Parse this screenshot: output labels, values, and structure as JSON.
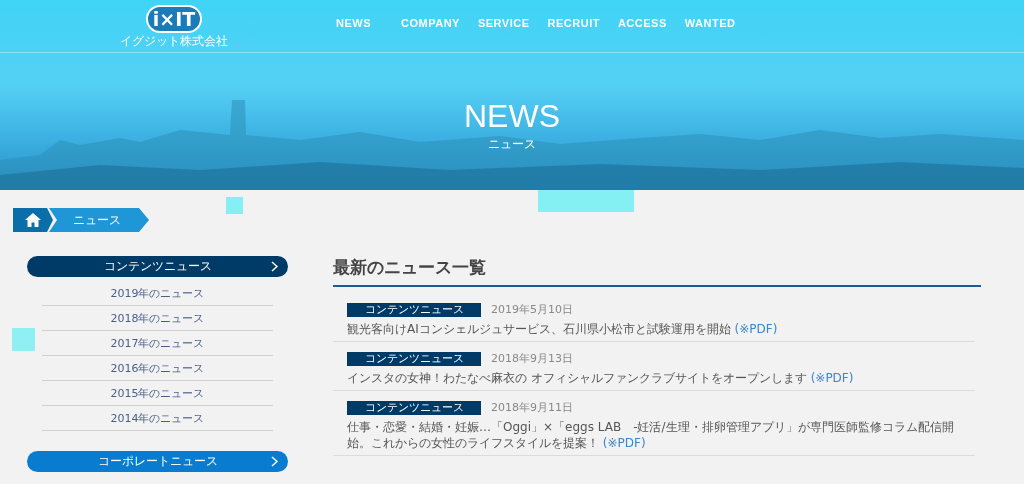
{
  "header": {
    "logo": {
      "mark": "i×IT",
      "company": "イグジット株式会社"
    },
    "nav": [
      "NEWS",
      "COMPANY",
      "SERVICE",
      "RECRUIT",
      "ACCESS",
      "WANTED"
    ]
  },
  "hero": {
    "title": "NEWS",
    "subtitle": "ニュース"
  },
  "breadcrumb": [
    "ニュース"
  ],
  "sidebar": [
    {
      "label": "コンテンツニュース",
      "selected": true,
      "items": [
        "2019年のニュース",
        "2018年のニュース",
        "2017年のニュース",
        "2016年のニュース",
        "2015年のニュース",
        "2014年のニュース"
      ]
    },
    {
      "label": "コーポレートニュース",
      "selected": false
    }
  ],
  "main": {
    "heading": "最新のニュース一覧",
    "news": [
      {
        "tag": "コンテンツニュース",
        "date": "2019年5月10日",
        "text": "観光客向けAIコンシェルジュサービス、石川県小松市と試験運用を開始",
        "link": "(※PDF)"
      },
      {
        "tag": "コンテンツニュース",
        "date": "2018年9月13日",
        "text": "インスタの女神！わたなべ麻衣の オフィシャルファンクラブサイトをオープンします",
        "link": "(※PDF)"
      },
      {
        "tag": "コンテンツニュース",
        "date": "2018年9月11日",
        "text": "仕事・恋愛・結婚・妊娠…「Oggi」×「eggs LAB　-妊活/生理・排卵管理アプリ」が専門医師監修コラム配信開始。これからの女性のライフスタイルを提案！",
        "link": "(※PDF)"
      }
    ]
  }
}
